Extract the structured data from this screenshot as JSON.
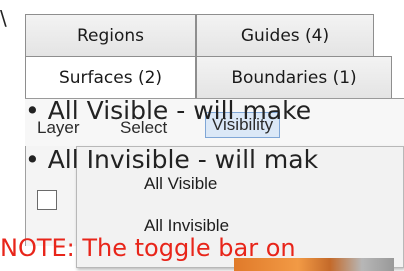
{
  "page": {
    "corner_glyph": "\\"
  },
  "tabs": [
    {
      "label": "Regions"
    },
    {
      "label": "Guides (4)"
    },
    {
      "label": "Surfaces (2)"
    },
    {
      "label": "Boundaries (1)"
    }
  ],
  "toolbar": {
    "layer_label": "Layer",
    "select_label": "Select",
    "visibility_label": "Visibility"
  },
  "dropdown": {
    "items": [
      {
        "label": "All Visible"
      },
      {
        "label": "All Invisible"
      }
    ]
  },
  "bullets": [
    {
      "text": "All Visible - will make"
    },
    {
      "text": "All Invisible - will mak"
    }
  ],
  "note": {
    "text": "NOTE: The toggle bar on",
    "color": "#e8251a"
  },
  "colors": {
    "accent_selection": "#dbe8f7",
    "toggle_bar": "#e07a2a"
  }
}
